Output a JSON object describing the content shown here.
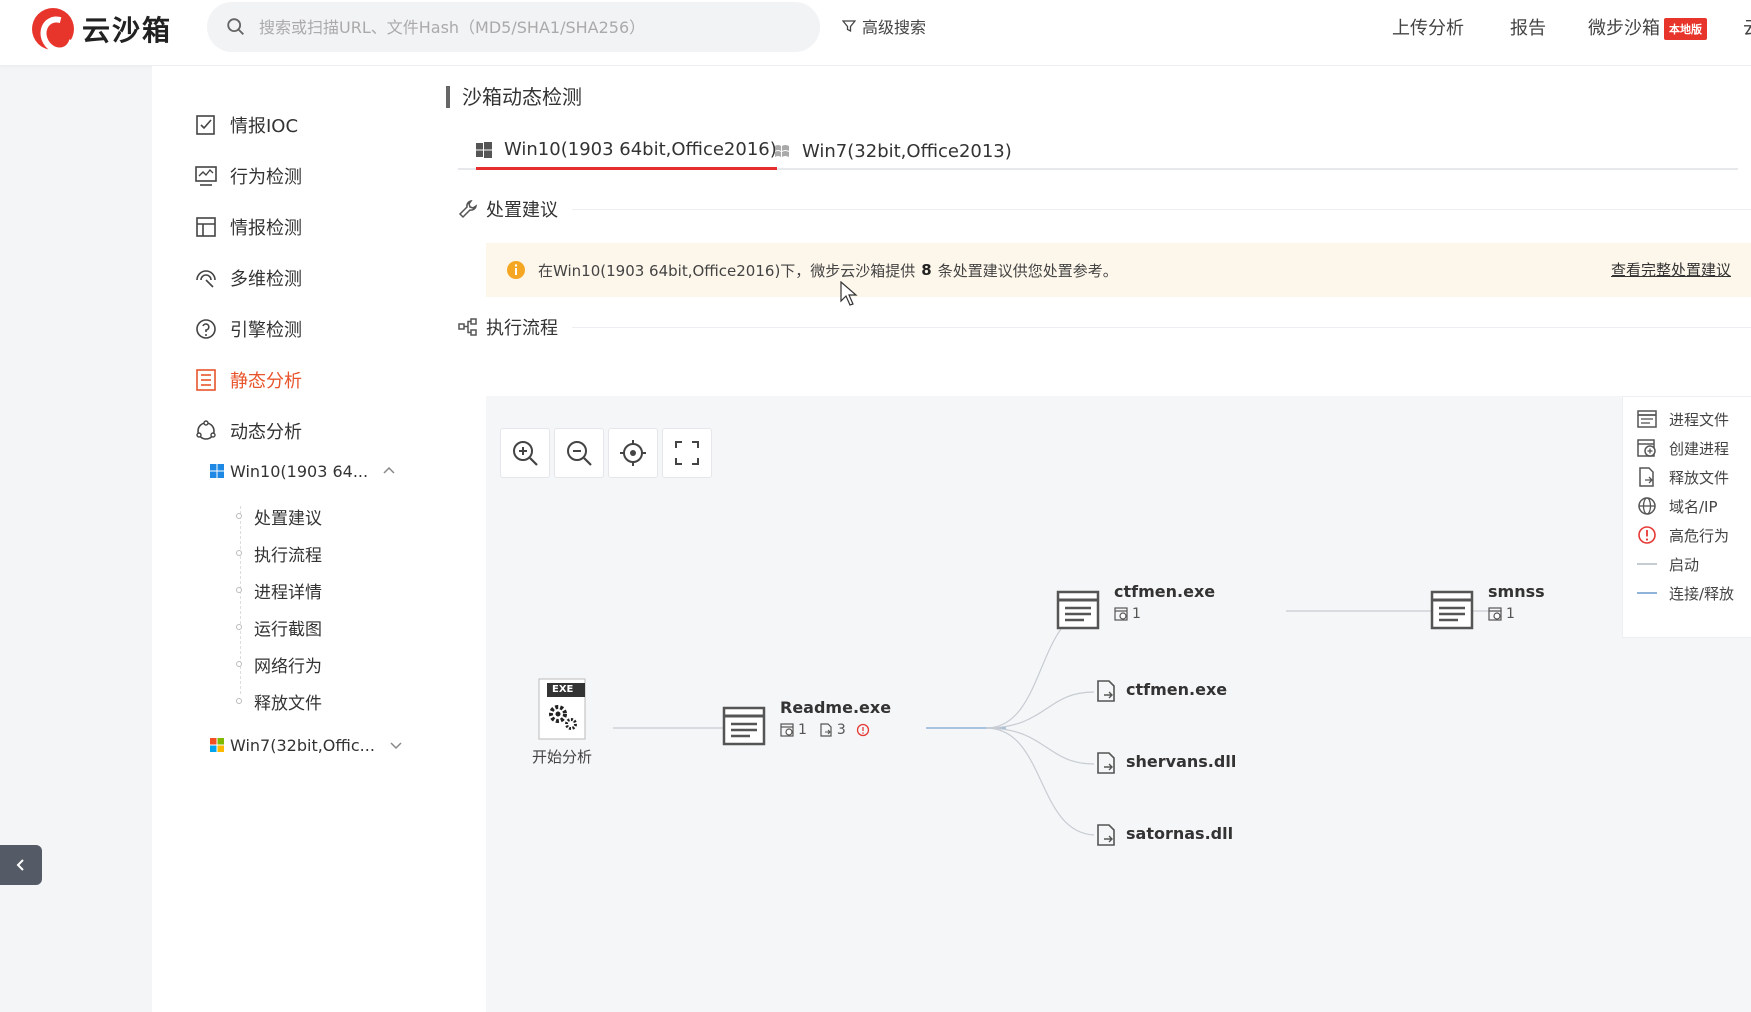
{
  "header": {
    "logo_text": "云沙箱",
    "search_placeholder": "搜索或扫描URL、文件Hash（MD5/SHA1/SHA256）",
    "advanced_search": "高级搜索",
    "nav": [
      "上传分析",
      "报告",
      "微步沙箱"
    ],
    "badge": "本地版",
    "nav_cut": "云"
  },
  "sidebar": {
    "items": [
      {
        "label": "情报IOC",
        "icon": "edit-check-icon"
      },
      {
        "label": "行为检测",
        "icon": "monitor-chart-icon"
      },
      {
        "label": "情报检测",
        "icon": "layout-icon"
      },
      {
        "label": "多维检测",
        "icon": "radar-icon"
      },
      {
        "label": "引擎检测",
        "icon": "compass-icon"
      },
      {
        "label": "静态分析",
        "icon": "list-doc-icon",
        "active": true
      },
      {
        "label": "动态分析",
        "icon": "cycle-icon"
      }
    ],
    "env1": "Win10(1903 64...",
    "env1_subitems": [
      "处置建议",
      "执行流程",
      "进程详情",
      "运行截图",
      "网络行为",
      "释放文件"
    ],
    "env2": "Win7(32bit,Offic..."
  },
  "main": {
    "title": "沙箱动态检测",
    "tabs": [
      "Win10(1903 64bit,Office2016)",
      "Win7(32bit,Office2013)"
    ],
    "section_advice": "处置建议",
    "notice_pre": "在Win10(1903 64bit,Office2016)下，微步云沙箱提供",
    "notice_count": "8",
    "notice_post": "条处置建议供您处置参考。",
    "notice_link": "查看完整处置建议",
    "section_flow": "执行流程"
  },
  "legend": [
    "进程文件",
    "创建进程",
    "释放文件",
    "域名/IP",
    "高危行为",
    "启动",
    "连接/释放"
  ],
  "flow": {
    "start_badge": "EXE",
    "start_label": "开始分析",
    "readme": {
      "name": "Readme.exe",
      "proc": "1",
      "files": "3"
    },
    "ctfmen_proc": {
      "name": "ctfmen.exe",
      "proc": "1"
    },
    "smnss": {
      "name": "smnss",
      "proc": "1"
    },
    "drops": [
      "ctfmen.exe",
      "shervans.dll",
      "satornas.dll"
    ]
  },
  "colors": {
    "accent": "#e8552c",
    "brand_red": "#e8352c",
    "tab_underline": "#e62e2e",
    "notice_bg": "#fdf6ea",
    "edge_blue": "#8fb3d9",
    "edge_gray": "#c7ccd3"
  }
}
